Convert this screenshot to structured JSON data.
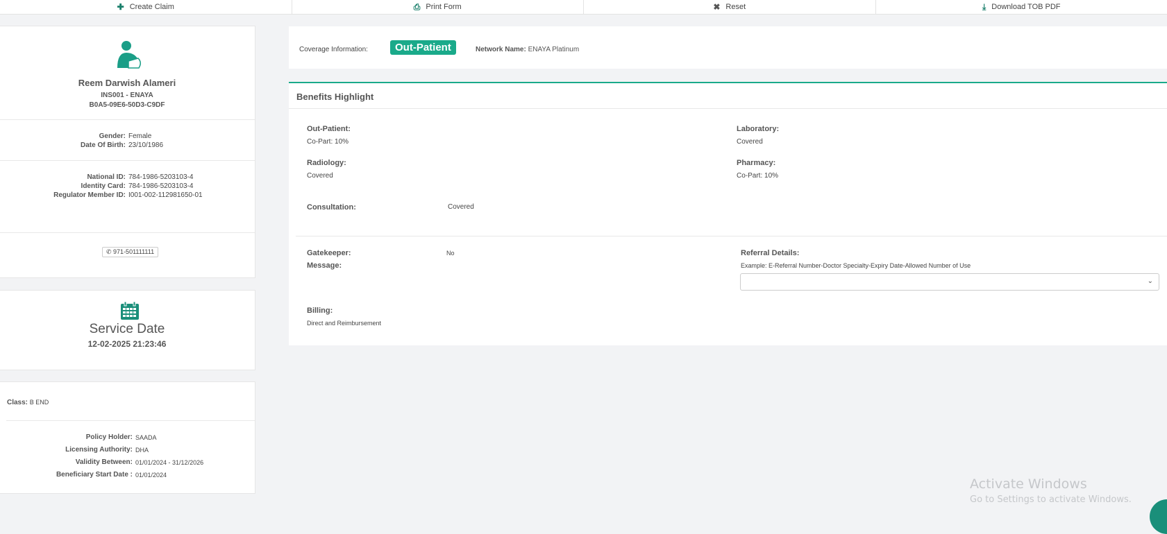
{
  "toolbar": [
    {
      "label": "Create Claim",
      "icon": "plus-icon"
    },
    {
      "label": "Print Form",
      "icon": "print-icon"
    },
    {
      "label": "Reset",
      "icon": "close-icon"
    },
    {
      "label": "Download TOB PDF",
      "icon": "download-icon"
    }
  ],
  "member": {
    "name": "Reem Darwish Alameri",
    "insurer": "INS001 - ENAYA",
    "code": "B0A5-09E6-50D3-C9DF",
    "gender_label": "Gender:",
    "gender": "Female",
    "dob_label": "Date Of Birth:",
    "dob": "23/10/1986",
    "national_id_label": "National ID:",
    "national_id": "784-1986-5203103-4",
    "identity_card_label": "Identity Card:",
    "identity_card": "784-1986-5203103-4",
    "regulator_label": "Regulator Member ID:",
    "regulator_id": "I001-002-112981650-01",
    "phone": "971-501111111"
  },
  "service": {
    "title": "Service Date",
    "date": "12-02-2025 21:23:46"
  },
  "policy": {
    "class_label": "Class:",
    "class": "B END",
    "holder_label": "Policy Holder:",
    "holder": "SAADA",
    "authority_label": "Licensing Authority:",
    "authority": "DHA",
    "validity_label": "Validity Between:",
    "validity": "01/01/2024 - 31/12/2026",
    "start_label": "Beneficiary Start Date :",
    "start": "01/01/2024"
  },
  "coverage": {
    "label": "Coverage Information:",
    "type": "Out-Patient",
    "network_label": "Network Name:",
    "network": "ENAYA Platinum"
  },
  "benefits": {
    "title": "Benefits Highlight",
    "outpatient_label": "Out-Patient:",
    "outpatient": "Co-Part: 10%",
    "laboratory_label": "Laboratory:",
    "laboratory": "Covered",
    "radiology_label": "Radiology:",
    "radiology": "Covered",
    "pharmacy_label": "Pharmacy:",
    "pharmacy": "Co-Part: 10%",
    "consultation_label": "Consultation:",
    "consultation": "Covered",
    "gatekeeper_label": "Gatekeeper:",
    "gatekeeper": "No",
    "message_label": "Message:",
    "referral_label": "Referral Details:",
    "referral_hint": "Example: E-Referral Number-Doctor Specialty-Expiry Date-Allowed Number of Use",
    "billing_label": "Billing:",
    "billing": "Direct and Reimbursement"
  },
  "watermark": {
    "title": "Activate Windows",
    "subtitle": "Go to Settings to activate Windows."
  },
  "colors": {
    "accent": "#1a8f7a",
    "badge": "#1aaa8a"
  }
}
